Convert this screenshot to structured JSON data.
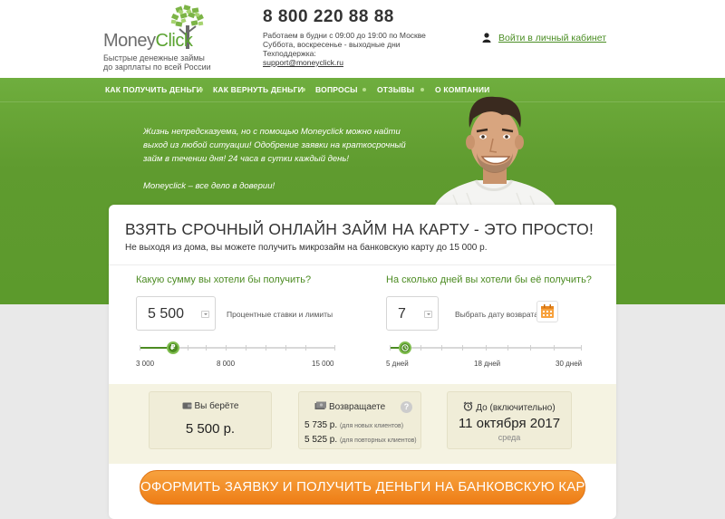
{
  "header": {
    "logo_money": "Money",
    "logo_click": "Click",
    "logo_tagline_1": "Быстрые денежные займы",
    "logo_tagline_2": "до зарплаты по всей России",
    "phone": "8 800 220 88 88",
    "hours_weekday": "Работаем в будни с 09:00 до 19:00 по Москве",
    "hours_weekend": "Суббота, воскресенье - выходные дни",
    "support_label": "Техподдержка:",
    "support_email": "support@moneyclick.ru",
    "login_link": "Войти в личный кабинет"
  },
  "nav": {
    "items": [
      {
        "label": "КАК ПОЛУЧИТЬ ДЕНЬГИ"
      },
      {
        "label": "КАК ВЕРНУТЬ ДЕНЬГИ"
      },
      {
        "label": "ВОПРОСЫ"
      },
      {
        "label": "ОТЗЫВЫ"
      },
      {
        "label": "О КОМПАНИИ"
      }
    ]
  },
  "hero": {
    "slogan_1": "Жизнь непредсказуема, но с помощью Moneyclick можно найти выход из любой ситуации! Одобрение заявки на краткосрочный займ в течении дня! 24 часа в сутки каждый день!",
    "slogan_2": "Moneyclick – все дело в доверии!"
  },
  "calculator": {
    "title": "ВЗЯТЬ СРОЧНЫЙ ОНЛАЙН ЗАЙМ НА КАРТУ - ЭТО ПРОСТО!",
    "subtitle": "Не выходя из дома, вы можете получить микрозайм на банковскую карту до 15 000 р.",
    "amount": {
      "question": "Какую сумму вы хотели бы получить?",
      "value": "5 500",
      "note": "Процентные ставки и лимиты",
      "min_label": "3 000",
      "mid_label": "8 000",
      "max_label": "15 000",
      "knob_symbol": "₽",
      "slider_position": 0.17
    },
    "days": {
      "question": "На сколько дней вы хотели бы её получить?",
      "value": "7",
      "note": "Выбрать дату возврата",
      "min_label": "5 дней",
      "mid_label": "18 дней",
      "max_label": "30 дней",
      "slider_position": 0.08
    },
    "summary": {
      "take_label": "Вы берёте",
      "take_value": "5 500 р.",
      "return_label": "Возвращаете",
      "return_new_value": "5 735 р.",
      "return_new_tag": "(для новых клиентов)",
      "return_repeat_value": "5 525 р.",
      "return_repeat_tag": "(для повторных клиентов)",
      "help_symbol": "?",
      "due_label": "До (включительно)",
      "due_date": "11 октября 2017",
      "due_weekday": "среда"
    },
    "cta": "ОФОРМИТЬ ЗАЯВКУ И ПОЛУЧИТЬ ДЕНЬГИ НА БАНКОВСКУЮ КАРТУ"
  },
  "colors": {
    "brand_green": "#5c9a2c",
    "accent_green": "#4c8b22",
    "cta_orange": "#ee7d16"
  }
}
